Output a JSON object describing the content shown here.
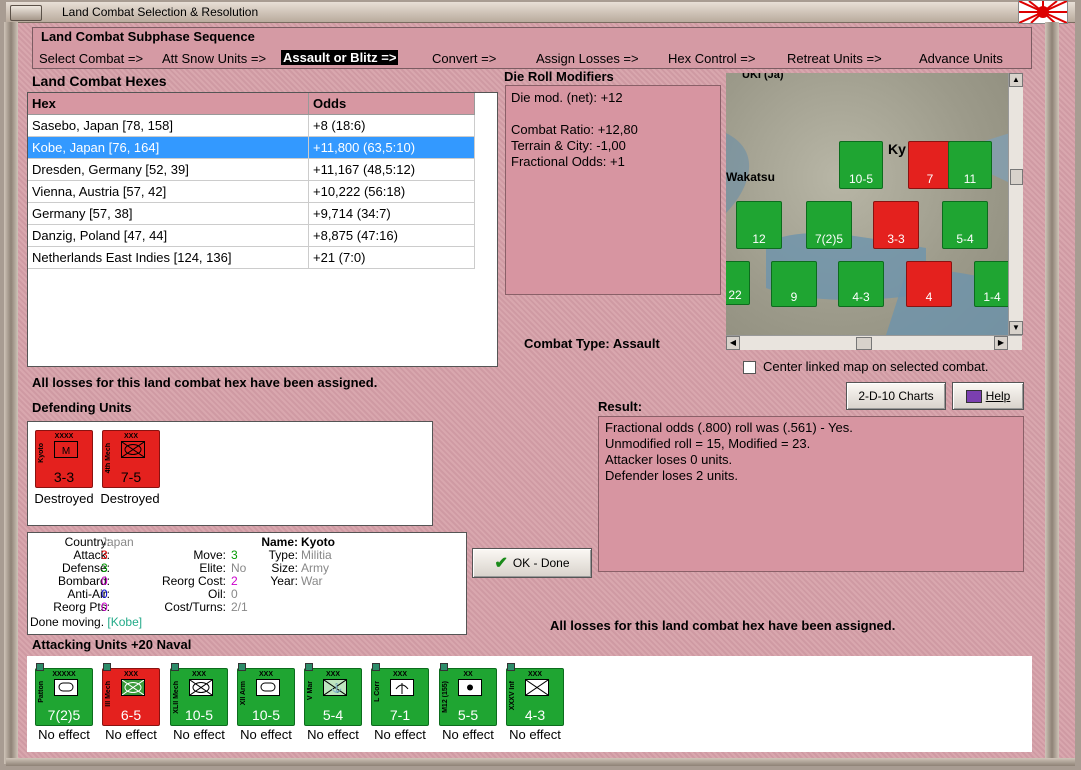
{
  "window": {
    "title": "Land Combat Selection & Resolution"
  },
  "subphase": {
    "heading": "Land Combat Subphase Sequence",
    "steps": [
      "Select Combat =>",
      "Att Snow Units =>",
      "Assault or Blitz =>",
      "Convert =>",
      "Assign Losses =>",
      "Hex Control =>",
      "Retreat Units =>",
      "Advance Units"
    ],
    "active_index": 2
  },
  "hexes": {
    "heading": "Land Combat Hexes",
    "columns": [
      "Hex",
      "Odds"
    ],
    "rows": [
      {
        "hex": "Sasebo, Japan [78, 158]",
        "odds": "+8 (18:6)"
      },
      {
        "hex": "Kobe, Japan [76, 164]",
        "odds": "+11,800 (63,5:10)"
      },
      {
        "hex": "Dresden, Germany [52, 39]",
        "odds": "+11,167 (48,5:12)"
      },
      {
        "hex": "Vienna, Austria [57, 42]",
        "odds": "+10,222 (56:18)"
      },
      {
        "hex": "Germany [57, 38]",
        "odds": "+9,714 (34:7)"
      },
      {
        "hex": "Danzig, Poland [47, 44]",
        "odds": "+8,875 (47:16)"
      },
      {
        "hex": "Netherlands East Indies [124, 136]",
        "odds": "+21 (7:0)"
      }
    ],
    "selected_index": 1
  },
  "modifiers": {
    "heading": "Die Roll Modifiers",
    "lines": [
      "Die mod. (net): +12",
      "",
      "Combat Ratio: +12,80",
      "Terrain & City: -1,00",
      "Fractional Odds: +1"
    ]
  },
  "combat_type": "Combat Type:  Assault",
  "center_map_label": "Center linked map on selected combat.",
  "losses_msg": "All losses for this land combat hex have been assigned.",
  "defending": {
    "heading": "Defending Units",
    "units": [
      {
        "size": "XXXX",
        "name": "Kyoto",
        "strength": "3-3",
        "symbol": "M",
        "status": "Destroyed"
      },
      {
        "size": "XXX",
        "name": "4th Mech",
        "strength": "7-5",
        "symbol": "mech",
        "status": "Destroyed"
      }
    ]
  },
  "buttons": {
    "charts": "2-D-10 Charts",
    "help": "Help",
    "ok": "OK - Done"
  },
  "result": {
    "heading": "Result:",
    "lines": [
      "Fractional odds (.800) roll was (.561)  - Yes.",
      "Unmodified roll = 15, Modified = 23.",
      "Attacker loses 0 units.",
      "Defender loses 2 units."
    ]
  },
  "unit_info": {
    "country_label": "Country:",
    "country": "Japan",
    "attack_label": "Attack:",
    "attack": "3",
    "defense_label": "Defense:",
    "defense": "3",
    "bombard_label": "Bombard:",
    "bombard": "0",
    "antiair_label": "Anti-Air:",
    "antiair": "0",
    "reorgpts_label": "Reorg Pts:",
    "reorgpts": "0",
    "name_label": "Name:",
    "name": "Kyoto",
    "move_label": "Move:",
    "move": "3",
    "type_label": "Type:",
    "type": "Militia",
    "elite_label": "Elite:",
    "elite": "No",
    "size_label": "Size:",
    "size": "Army",
    "reorgcost_label": "Reorg Cost:",
    "reorgcost": "2",
    "year_label": "Year:",
    "year": "War",
    "oil_label": "Oil:",
    "oil": "0",
    "costturns_label": "Cost/Turns:",
    "costturns": "2/1",
    "done_moving": "Done moving.",
    "location": "[Kobe]"
  },
  "attacking": {
    "heading": "Attacking Units +20 Naval",
    "units": [
      {
        "size": "XXXXX",
        "name": "Patton",
        "strength": "7(2)5",
        "color": "green",
        "symbol": "arm",
        "status": "No effect"
      },
      {
        "size": "XXX",
        "name": "III Mech",
        "strength": "6-5",
        "color": "red",
        "symbol": "mech",
        "status": "No effect"
      },
      {
        "size": "XXX",
        "name": "XLII Mech",
        "strength": "10-5",
        "color": "green",
        "symbol": "mech",
        "status": "No effect"
      },
      {
        "size": "XXX",
        "name": "XII Arm",
        "strength": "10-5",
        "color": "green",
        "symbol": "arm",
        "status": "No effect"
      },
      {
        "size": "XXX",
        "name": "V Mar",
        "strength": "5-4",
        "color": "green",
        "symbol": "mar",
        "status": "No effect"
      },
      {
        "size": "XXX",
        "name": "L Corr",
        "strength": "7-1",
        "color": "green",
        "symbol": "para",
        "status": "No effect"
      },
      {
        "size": "XX",
        "name": "M12 (155)",
        "strength": "5-5",
        "color": "green",
        "symbol": "art",
        "status": "No effect"
      },
      {
        "size": "XXX",
        "name": "XXXV Inf",
        "strength": "4-3",
        "color": "green",
        "symbol": "inf",
        "status": "No effect"
      }
    ]
  },
  "map": {
    "labels": [
      "UKI (Ja)",
      "Ky",
      "Wakatsu"
    ],
    "counters": [
      {
        "strength": "10-5",
        "color": "green"
      },
      {
        "strength": "7",
        "color": "red"
      },
      {
        "strength": "11",
        "color": "green"
      },
      {
        "strength": "12",
        "color": "green"
      },
      {
        "strength": "7(2)5",
        "color": "green"
      },
      {
        "strength": "3-3",
        "color": "red"
      },
      {
        "strength": "5-4",
        "color": "green"
      },
      {
        "strength": "22",
        "color": "green"
      },
      {
        "strength": "9",
        "color": "green"
      },
      {
        "strength": "4-3",
        "color": "green"
      },
      {
        "strength": "4",
        "color": "red"
      },
      {
        "strength": "1-4",
        "color": "green"
      }
    ]
  },
  "colors": {
    "pink_bg": "#c98e98",
    "panel_pink": "#d795a1",
    "selection": "#3399ff",
    "green": "#1fa532",
    "red": "#e4211e"
  }
}
